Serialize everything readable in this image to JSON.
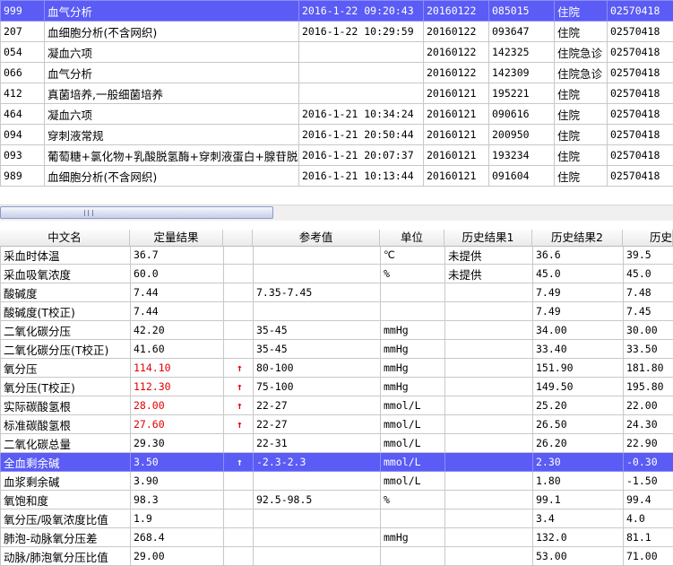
{
  "top_rows": [
    [
      "999",
      "血气分析",
      "2016-1-22 09:20:43",
      "20160122",
      "085015",
      "住院",
      "02570418"
    ],
    [
      "207",
      "血细胞分析(不含网织)",
      "2016-1-22 10:29:59",
      "20160122",
      "093647",
      "住院",
      "02570418"
    ],
    [
      "054",
      "凝血六项",
      "",
      "20160122",
      "142325",
      "住院急诊",
      "02570418"
    ],
    [
      "066",
      "血气分析",
      "",
      "20160122",
      "142309",
      "住院急诊",
      "02570418"
    ],
    [
      "412",
      "真菌培养,一般细菌培养",
      "",
      "20160121",
      "195221",
      "住院",
      "02570418"
    ],
    [
      "464",
      "凝血六项",
      "2016-1-21 10:34:24",
      "20160121",
      "090616",
      "住院",
      "02570418"
    ],
    [
      "094",
      "穿刺液常规",
      "2016-1-21 20:50:44",
      "20160121",
      "200950",
      "住院",
      "02570418"
    ],
    [
      "093",
      "葡萄糖+氯化物+乳酸脱氢酶+穿刺液蛋白+腺苷脱",
      "2016-1-21 20:07:37",
      "20160121",
      "193234",
      "住院",
      "02570418"
    ],
    [
      "989",
      "血细胞分析(不含网织)",
      "2016-1-21 10:13:44",
      "20160121",
      "091604",
      "住院",
      "02570418"
    ]
  ],
  "scrollbar": {
    "grip": "III"
  },
  "headers": [
    "中文名",
    "定量结果",
    "",
    "参考值",
    "单位",
    "历史结果1",
    "历史结果2",
    "历史结"
  ],
  "rows": [
    {
      "name": "采血时体温",
      "value": "36.7",
      "flag": "",
      "ref": "",
      "unit": "℃",
      "h1": "未提供",
      "h2": "36.6",
      "h3": "39.5",
      "high": false
    },
    {
      "name": "采血吸氧浓度",
      "value": "60.0",
      "flag": "",
      "ref": "",
      "unit": "%",
      "h1": "未提供",
      "h2": "45.0",
      "h3": "45.0",
      "high": false
    },
    {
      "name": "酸碱度",
      "value": "7.44",
      "flag": "",
      "ref": "7.35-7.45",
      "unit": "",
      "h1": "",
      "h2": "7.49",
      "h3": "7.48",
      "high": false
    },
    {
      "name": "酸碱度(T校正)",
      "value": "7.44",
      "flag": "",
      "ref": "",
      "unit": "",
      "h1": "",
      "h2": "7.49",
      "h3": "7.45",
      "high": false
    },
    {
      "name": "二氧化碳分压",
      "value": "42.20",
      "flag": "",
      "ref": "35-45",
      "unit": "mmHg",
      "h1": "",
      "h2": "34.00",
      "h3": "30.00",
      "high": false
    },
    {
      "name": "二氧化碳分压(T校正)",
      "value": "41.60",
      "flag": "",
      "ref": "35-45",
      "unit": "mmHg",
      "h1": "",
      "h2": "33.40",
      "h3": "33.50",
      "high": false
    },
    {
      "name": "氧分压",
      "value": "114.10",
      "flag": "↑",
      "ref": "80-100",
      "unit": "mmHg",
      "h1": "",
      "h2": "151.90",
      "h3": "181.80",
      "high": true
    },
    {
      "name": "氧分压(T校正)",
      "value": "112.30",
      "flag": "↑",
      "ref": "75-100",
      "unit": "mmHg",
      "h1": "",
      "h2": "149.50",
      "h3": "195.80",
      "high": true
    },
    {
      "name": "实际碳酸氢根",
      "value": "28.00",
      "flag": "↑",
      "ref": "22-27",
      "unit": "mmol/L",
      "h1": "",
      "h2": "25.20",
      "h3": "22.00",
      "high": true
    },
    {
      "name": "标准碳酸氢根",
      "value": "27.60",
      "flag": "↑",
      "ref": "22-27",
      "unit": "mmol/L",
      "h1": "",
      "h2": "26.50",
      "h3": "24.30",
      "high": true
    },
    {
      "name": "二氧化碳总量",
      "value": "29.30",
      "flag": "",
      "ref": "22-31",
      "unit": "mmol/L",
      "h1": "",
      "h2": "26.20",
      "h3": "22.90",
      "high": false
    },
    {
      "name": "全血剩余碱",
      "value": "3.50",
      "flag": "↑",
      "ref": "-2.3-2.3",
      "unit": "mmol/L",
      "h1": "",
      "h2": "2.30",
      "h3": "-0.30",
      "high": false
    },
    {
      "name": "血浆剩余碱",
      "value": "3.90",
      "flag": "",
      "ref": "",
      "unit": "mmol/L",
      "h1": "",
      "h2": "1.80",
      "h3": "-1.50",
      "high": false
    },
    {
      "name": "氧饱和度",
      "value": "98.3",
      "flag": "",
      "ref": "92.5-98.5",
      "unit": "%",
      "h1": "",
      "h2": "99.1",
      "h3": "99.4",
      "high": false
    },
    {
      "name": "氧分压/吸氧浓度比值",
      "value": "1.9",
      "flag": "",
      "ref": "",
      "unit": "",
      "h1": "",
      "h2": "3.4",
      "h3": "4.0",
      "high": false
    },
    {
      "name": "肺泡-动脉氧分压差",
      "value": "268.4",
      "flag": "",
      "ref": "",
      "unit": "mmHg",
      "h1": "",
      "h2": "132.0",
      "h3": "81.1",
      "high": false
    },
    {
      "name": "动脉/肺泡氧分压比值",
      "value": "29.00",
      "flag": "",
      "ref": "",
      "unit": "",
      "h1": "",
      "h2": "53.00",
      "h3": "71.00",
      "high": false
    }
  ],
  "colors": {
    "selection": "#5b5bf5",
    "high": "#e00000"
  }
}
